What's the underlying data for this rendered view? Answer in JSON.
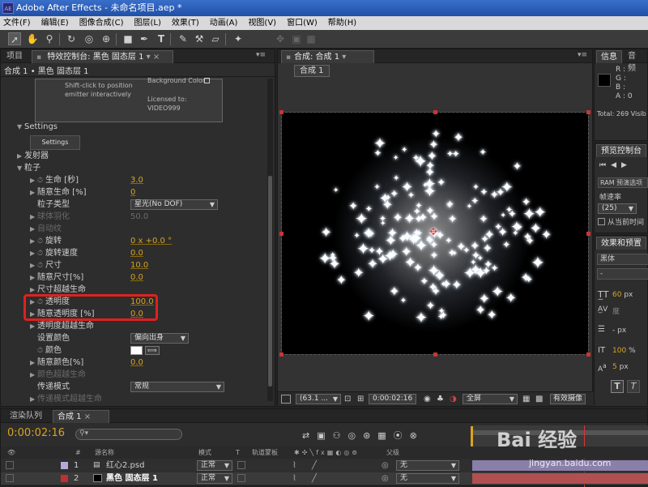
{
  "window": {
    "title": "Adobe After Effects - 未命名项目.aep *",
    "app_icon": "AE"
  },
  "menu": [
    "文件(F)",
    "编辑(E)",
    "图像合成(C)",
    "图层(L)",
    "效果(T)",
    "动画(A)",
    "视图(V)",
    "窗口(W)",
    "帮助(H)"
  ],
  "project_tab": "项目",
  "effect_controls": {
    "tab": "特效控制台: 黑色 固态层 1",
    "breadcrumb": "合成 1 • 黑色 固态层 1",
    "shift_hint_line1": "Shift-click to position",
    "shift_hint_line2": "emitter interactively",
    "bg_color": "Background Color",
    "licensed": "Licensed to:",
    "license_user": "VIDEO999",
    "settings_header": "Settings",
    "settings_button": "Settings",
    "rows": [
      {
        "label": "发射器"
      },
      {
        "label": "粒子"
      },
      {
        "label": "生命 [秒]",
        "value": "3.0"
      },
      {
        "label": "随意生命 [%]",
        "value": "0"
      },
      {
        "label": "粒子类型",
        "value": "星光(No DOF)"
      },
      {
        "label": "球体羽化",
        "value": "50.0"
      },
      {
        "label": "自动纹"
      },
      {
        "label": "旋转",
        "value": "0 x +0.0 °"
      },
      {
        "label": "旋转速度",
        "value": "0.0"
      },
      {
        "label": "尺寸",
        "value": "10.0"
      },
      {
        "label": "随意尺寸[%]",
        "value": "0.0"
      },
      {
        "label": "尺寸超越生命"
      },
      {
        "label": "透明度",
        "value": "100.0"
      },
      {
        "label": "随意透明度 [%]",
        "value": "0.0"
      },
      {
        "label": "透明度超越生命"
      },
      {
        "label": "设置颜色",
        "value": "偏向出身"
      },
      {
        "label": "颜色"
      },
      {
        "label": "随意颜色[%]",
        "value": "0.0"
      },
      {
        "label": "颜色超越生命"
      },
      {
        "label": "传递模式",
        "value": "常规"
      },
      {
        "label": "传递模式超越生命"
      }
    ]
  },
  "composition": {
    "tab": "合成: 合成 1",
    "subtab": "合成 1",
    "zoom": "(63.1 ...",
    "timecode": "0:00:02:16",
    "resolution": "全屏",
    "camera": "有效摄像"
  },
  "info": {
    "tab": "信息",
    "tab2": "音频",
    "r": "R :",
    "g": "G :",
    "b": "B :",
    "a": "A : 0",
    "total": "Total: 269  Visib"
  },
  "preview": {
    "tab": "预览控制台",
    "ram": "RAM 预演选项",
    "frame_rate": "帧速率",
    "frame_rate_value": "(25)",
    "from_current": "从当前时间"
  },
  "effects_presets": {
    "tab": "效果和预置",
    "font": "黑体",
    "font_style": "-",
    "size": "60",
    "size_unit": "px",
    "tracking": "度",
    "indent": "- px",
    "vscale": "100",
    "vscale_unit": "%",
    "baseline": "5",
    "baseline_unit": "px"
  },
  "timeline": {
    "tab_render": "渲染队列",
    "tab_comp": "合成 1",
    "timecode": "0:00:02:16",
    "headers": {
      "num": "#",
      "source": "源名称",
      "mode": "模式",
      "t": "T",
      "trkmat": "轨道蒙板",
      "parent": "父级"
    },
    "layers": [
      {
        "num": "1",
        "name": "红心2.psd",
        "mode": "正常",
        "parent": "无",
        "color": "#b8a8d8"
      },
      {
        "num": "2",
        "name": "黑色 固态层 1",
        "mode": "正常",
        "parent": "无",
        "color": "#c03030"
      }
    ]
  },
  "watermark": {
    "brand": "Bai 经验",
    "url": "jingyan.baidu.com"
  }
}
